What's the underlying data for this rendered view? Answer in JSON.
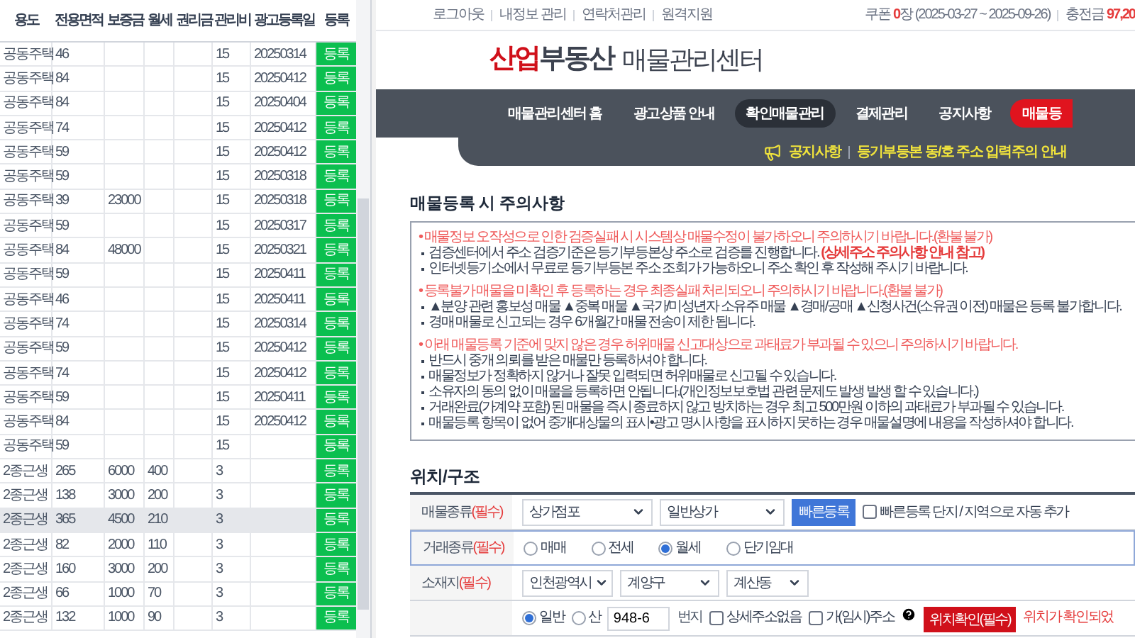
{
  "table": {
    "columns": [
      "용도",
      "전용면적",
      "보증금",
      "월세",
      "권리금",
      "관리비",
      "광고등록일",
      "등록"
    ],
    "rows": [
      {
        "use": "공동주택",
        "area": "46",
        "fee": "15",
        "date": "20250314",
        "button": "등록",
        "selected": false
      },
      {
        "use": "공동주택",
        "area": "84",
        "fee": "15",
        "date": "20250412",
        "button": "등록",
        "selected": false
      },
      {
        "use": "공동주택",
        "area": "84",
        "fee": "15",
        "date": "20250404",
        "button": "등록",
        "selected": false
      },
      {
        "use": "공동주택",
        "area": "74",
        "fee": "15",
        "date": "20250412",
        "button": "등록",
        "selected": false
      },
      {
        "use": "공동주택",
        "area": "59",
        "fee": "15",
        "date": "20250412",
        "button": "등록",
        "selected": false
      },
      {
        "use": "공동주택",
        "area": "59",
        "fee": "15",
        "date": "20250318",
        "button": "등록",
        "selected": false
      },
      {
        "use": "공동주택",
        "area": "39",
        "deposit": "23000",
        "fee": "15",
        "date": "20250318",
        "button": "등록",
        "selected": false
      },
      {
        "use": "공동주택",
        "area": "59",
        "fee": "15",
        "date": "20250317",
        "button": "등록",
        "selected": false
      },
      {
        "use": "공동주택",
        "area": "84",
        "deposit": "48000",
        "fee": "15",
        "date": "20250321",
        "button": "등록",
        "selected": false
      },
      {
        "use": "공동주택",
        "area": "59",
        "fee": "15",
        "date": "20250411",
        "button": "등록",
        "selected": false
      },
      {
        "use": "공동주택",
        "area": "46",
        "fee": "15",
        "date": "20250411",
        "button": "등록",
        "selected": false
      },
      {
        "use": "공동주택",
        "area": "74",
        "fee": "15",
        "date": "20250314",
        "button": "등록",
        "selected": false
      },
      {
        "use": "공동주택",
        "area": "59",
        "fee": "15",
        "date": "20250412",
        "button": "등록",
        "selected": false
      },
      {
        "use": "공동주택",
        "area": "74",
        "fee": "15",
        "date": "20250412",
        "button": "등록",
        "selected": false
      },
      {
        "use": "공동주택",
        "area": "59",
        "fee": "15",
        "date": "20250411",
        "button": "등록",
        "selected": false
      },
      {
        "use": "공동주택",
        "area": "84",
        "fee": "15",
        "date": "20250412",
        "button": "등록",
        "selected": false
      },
      {
        "use": "공동주택",
        "area": "59",
        "fee": "15",
        "button": "등록",
        "selected": false
      },
      {
        "use": "2종근생",
        "area": "265",
        "deposit": "6000",
        "rent": "400",
        "fee": "3",
        "button": "등록",
        "selected": false
      },
      {
        "use": "2종근생",
        "area": "138",
        "deposit": "3000",
        "rent": "200",
        "fee": "3",
        "button": "등록",
        "selected": false
      },
      {
        "use": "2종근생",
        "area": "365",
        "deposit": "4500",
        "rent": "210",
        "fee": "3",
        "button": "등록",
        "selected": true
      },
      {
        "use": "2종근생",
        "area": "82",
        "deposit": "2000",
        "rent": "110",
        "fee": "3",
        "button": "등록",
        "selected": false
      },
      {
        "use": "2종근생",
        "area": "160",
        "deposit": "3000",
        "rent": "200",
        "fee": "3",
        "button": "등록",
        "selected": false
      },
      {
        "use": "2종근생",
        "area": "66",
        "deposit": "1000",
        "rent": "70",
        "fee": "3",
        "button": "등록",
        "selected": false
      },
      {
        "use": "2종근생",
        "area": "132",
        "deposit": "1000",
        "rent": "90",
        "fee": "3",
        "button": "등록",
        "selected": false
      }
    ]
  },
  "top_links": [
    "로그아웃",
    "내정보 관리",
    "연락처관리",
    "원격지원"
  ],
  "coupon": {
    "label": "쿠폰",
    "count": "0",
    "unit": "장",
    "period": "(2025-03-27 ~ 2025-09-26)"
  },
  "charge": {
    "label": "충전금",
    "amount": "97,20"
  },
  "logo": {
    "accent": "산업",
    "main": "부동산",
    "sub": "매물관리센터"
  },
  "nav": [
    {
      "label": "매물관리센터 홈",
      "kind": "link",
      "selected": false
    },
    {
      "label": "광고상품 안내",
      "kind": "link",
      "selected": false
    },
    {
      "label": "확인매물관리",
      "kind": "link",
      "selected": true
    },
    {
      "label": "결제관리",
      "kind": "link",
      "selected": false
    },
    {
      "label": "공지사항",
      "kind": "link",
      "selected": false
    },
    {
      "label": "매물등",
      "kind": "cta",
      "selected": false
    }
  ],
  "notice": {
    "label": "공지사항",
    "text": "등기부등본 동/호 주소 입력주의 안내"
  },
  "caution": {
    "title": "매물등록 시 주의사항",
    "groups": [
      {
        "heading": "• 매물정보 오작성으로 인한 검증실패 시 시스템상 매물수정이 불가하오니 주의하시기 바랍니다.(환불 불가)",
        "items": [
          {
            "text": "검증센터에서 주소 검증기준은 등기부등본상 주소로 검증를 진행합니다.",
            "note": "(상세주소 주의사항 안내 참고)"
          },
          {
            "text": "인터넷등기소에서 무료로 등기부등본 주소 조회가 가능하오니 주소 확인 후 작성해 주시기 바랍니다."
          }
        ]
      },
      {
        "heading": "• 등록불가 매물을 미확인 후 등록하는 경우 최종실패 처리되오니 주의하시기 바랍니다.(환불 불가)",
        "items": [
          {
            "text": "▲분양 관련 홍보성 매물 ▲중복 매물 ▲국가/미성년자 소유주 매물 ▲경매/공매 ▲신청사건(소유권 이전) 매물은 등록 불가합니다."
          },
          {
            "text": "경매 매물로 신고되는 경우 6개월간 매물 전송이 제한 됩니다."
          }
        ]
      },
      {
        "heading": "• 아래 매물등록 기준에 맞지 않은 경우 허위매물 신고대상으로 과태료가 부과될 수 있으니 주의하시기 바랍니다.",
        "items": [
          {
            "text": "반드시 중개 의뢰를 받은 매물만 등록하셔야 합니다."
          },
          {
            "text": "매물정보가 정확하지 않거나 잘못 입력되면 허위매물로 신고될 수 있습니다."
          },
          {
            "text": "소유자의 동의 없이 매물을 등록하면 안됩니다.(개인정보보호법 관련 문제도 발생 발생 할 수 있습니다.)"
          },
          {
            "text": "거래완료(가계약 포함) 된 매물을 즉시 종료하지 않고 방치하는 경우 최고 500만원 이하의 과태료가 부과될 수 있습니다."
          },
          {
            "text": "매물등록 항목이 없어 중개대상물의 표시•광고 명시사항을 표시하지 못하는 경우 매물설명에 내용을 작성하셔야 합니다."
          }
        ]
      }
    ]
  },
  "location": {
    "title": "위치/구조",
    "rows": [
      {
        "kind": "type",
        "label": "매물종류",
        "required": "(필수)",
        "highlighted": false,
        "selects": [
          "상가점포",
          "일반상가"
        ],
        "button": "빠른등록",
        "checkbox": {
          "label": "빠른등록 단지 / 지역으로 자동 추가",
          "checked": false
        }
      },
      {
        "kind": "radios",
        "label": "거래종류",
        "required": "(필수)",
        "highlighted": true,
        "options": [
          {
            "label": "매매",
            "selected": false
          },
          {
            "label": "전세",
            "selected": false
          },
          {
            "label": "월세",
            "selected": true
          },
          {
            "label": "단기임대",
            "selected": false
          }
        ]
      },
      {
        "kind": "address",
        "label": "소재지",
        "required": "(필수)",
        "highlighted": false,
        "selects": [
          "인천광역시",
          "계양구",
          "계산동"
        ]
      },
      {
        "kind": "lot",
        "highlighted": false,
        "options": [
          {
            "label": "일반",
            "selected": true
          },
          {
            "label": "산",
            "selected": false
          }
        ],
        "value": "948-6",
        "unit": "번지",
        "checkboxes": [
          {
            "label": "상세주소없음",
            "checked": false
          },
          {
            "label": "가(임시)주소",
            "checked": false
          }
        ],
        "button": "위치확인(필수)",
        "message": "위치가 확인되었"
      }
    ]
  }
}
